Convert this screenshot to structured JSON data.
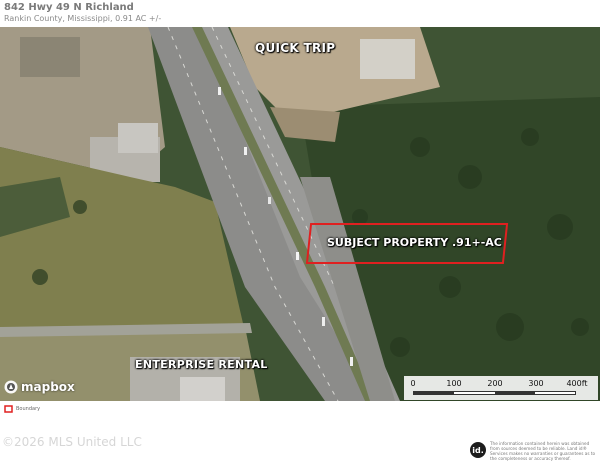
{
  "header": {
    "title": "842 Hwy 49 N Richland",
    "subtitle": "Rankin County, Mississippi, 0.91 AC +/-"
  },
  "map": {
    "labels": {
      "quick_trip": "QUICK TRIP",
      "enterprise_rental": "ENTERPRISE RENTAL",
      "subject_property": "SUBJECT PROPERTY .91+-AC"
    },
    "boundary_color": "#e02020",
    "attribution_logo": "mapbox",
    "scale": {
      "ticks": [
        "0",
        "100",
        "200",
        "300",
        "400ft"
      ]
    }
  },
  "legend": {
    "label": "Boundary",
    "icon": "boundary-swatch-icon"
  },
  "footer": {
    "copyright": "©2026 MLS United LLC",
    "badge": "id.",
    "disclaimer": "The information contained herein was obtained from sources deemed to be reliable. Land id® Services makes no warranties or guarantees as to the completeness or accuracy thereof."
  }
}
